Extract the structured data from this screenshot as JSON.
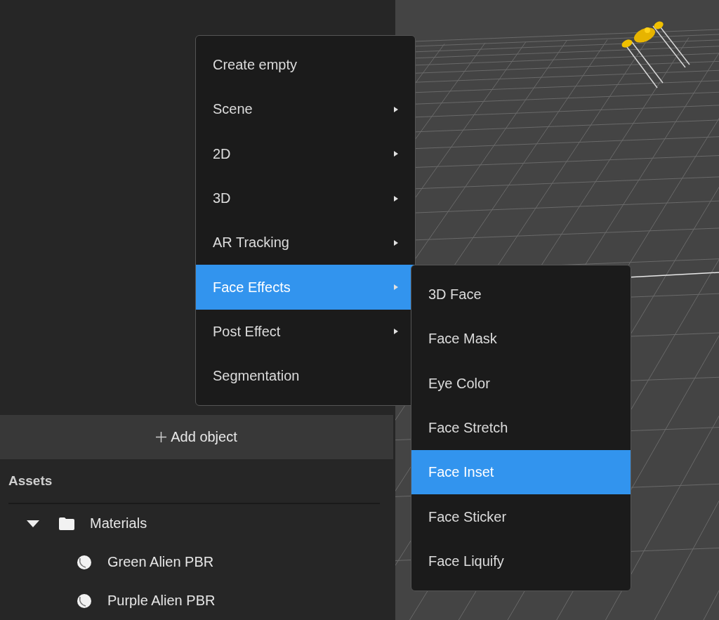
{
  "menu": {
    "items": [
      {
        "label": "Create empty",
        "submenu": false,
        "selected": false
      },
      {
        "label": "Scene",
        "submenu": true,
        "selected": false
      },
      {
        "label": "2D",
        "submenu": true,
        "selected": false
      },
      {
        "label": "3D",
        "submenu": true,
        "selected": false
      },
      {
        "label": "AR Tracking",
        "submenu": true,
        "selected": false
      },
      {
        "label": "Face Effects",
        "submenu": true,
        "selected": true
      },
      {
        "label": "Post Effect",
        "submenu": true,
        "selected": false
      },
      {
        "label": "Segmentation",
        "submenu": false,
        "selected": false
      }
    ]
  },
  "submenu": {
    "items": [
      {
        "label": "3D Face",
        "selected": false
      },
      {
        "label": "Face Mask",
        "selected": false
      },
      {
        "label": "Eye Color",
        "selected": false
      },
      {
        "label": "Face Stretch",
        "selected": false
      },
      {
        "label": "Face Inset",
        "selected": true
      },
      {
        "label": "Face Sticker",
        "selected": false
      },
      {
        "label": "Face Liquify",
        "selected": false
      }
    ]
  },
  "add_object": {
    "label": "Add object"
  },
  "assets": {
    "title": "Assets",
    "tree": [
      {
        "label": "Materials",
        "expanded": true,
        "children": [
          {
            "label": "Green Alien PBR"
          },
          {
            "label": "Purple Alien PBR"
          }
        ]
      }
    ]
  }
}
